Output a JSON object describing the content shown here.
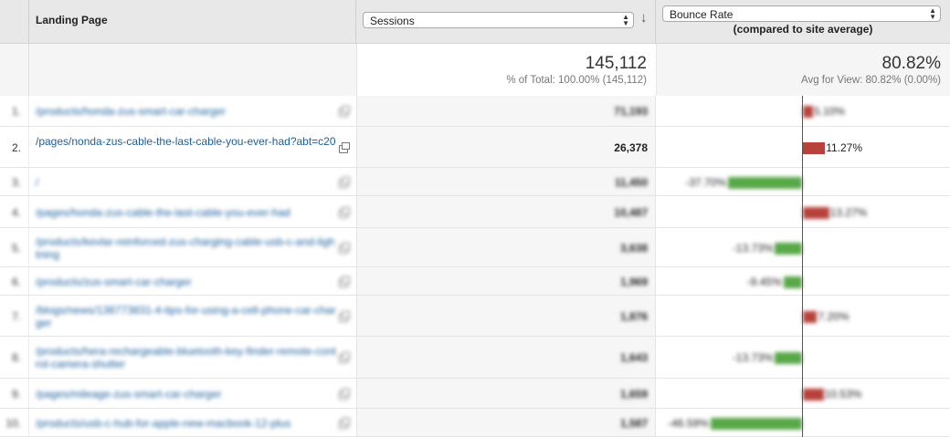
{
  "header": {
    "landing_label": "Landing Page",
    "sessions_select": "Sessions",
    "bounce_select": "Bounce Rate",
    "bounce_subtitle": "(compared to site average)"
  },
  "totals": {
    "sessions": "145,112",
    "sessions_sub": "% of Total: 100.00% (145,112)",
    "bounce": "80.82%",
    "bounce_sub": "Avg for View: 80.82% (0.00%)"
  },
  "rows": [
    {
      "idx": "1.",
      "page": "/products/honda-zus-smart-car-charger",
      "sessions": "71,193",
      "bounce_label": "5.10%",
      "bounce_delta": 5.1,
      "blurred": true
    },
    {
      "idx": "2.",
      "page": "/pages/nonda-zus-cable-the-last-cable-you-ever-had?abt=c20",
      "sessions": "26,378",
      "bounce_label": "11.27%",
      "bounce_delta": 11.27,
      "blurred": false
    },
    {
      "idx": "3.",
      "page": "/",
      "sessions": "11,450",
      "bounce_label": "-37.70%",
      "bounce_delta": -37.7,
      "blurred": true
    },
    {
      "idx": "4.",
      "page": "/pages/honda-zus-cable-the-last-cable-you-ever-had",
      "sessions": "10,487",
      "bounce_label": "13.27%",
      "bounce_delta": 13.27,
      "blurred": true
    },
    {
      "idx": "5.",
      "page": "/products/kevlar-reinforced-zus-charging-cable-usb-c-and-lightning",
      "sessions": "3,638",
      "bounce_label": "-13.73%",
      "bounce_delta": -13.73,
      "blurred": true
    },
    {
      "idx": "6.",
      "page": "/products/zus-smart-car-charger",
      "sessions": "1,969",
      "bounce_label": "-9.45%",
      "bounce_delta": -9.45,
      "blurred": true
    },
    {
      "idx": "7.",
      "page": "/blogs/news/138773831-4-tips-for-using-a-cell-phone-car-charger",
      "sessions": "1,876",
      "bounce_label": "7.20%",
      "bounce_delta": 7.2,
      "blurred": true
    },
    {
      "idx": "8.",
      "page": "/products/hera-rechargeable-bluetooth-key-finder-remote-control-camera-shutter",
      "sessions": "1,643",
      "bounce_label": "-13.73%",
      "bounce_delta": -13.73,
      "blurred": true
    },
    {
      "idx": "9.",
      "page": "/pages/mileage-zus-smart-car-charger",
      "sessions": "1,659",
      "bounce_label": "10.53%",
      "bounce_delta": 10.53,
      "blurred": true
    },
    {
      "idx": "10.",
      "page": "/products/usb-c-hub-for-apple-new-macbook-12-plus",
      "sessions": "1,587",
      "bounce_label": "-46.59%",
      "bounce_delta": -46.59,
      "blurred": true
    }
  ],
  "colors": {
    "positive_bar": "#b8413b",
    "negative_bar": "#58a848",
    "link": "#1a5f9e"
  }
}
